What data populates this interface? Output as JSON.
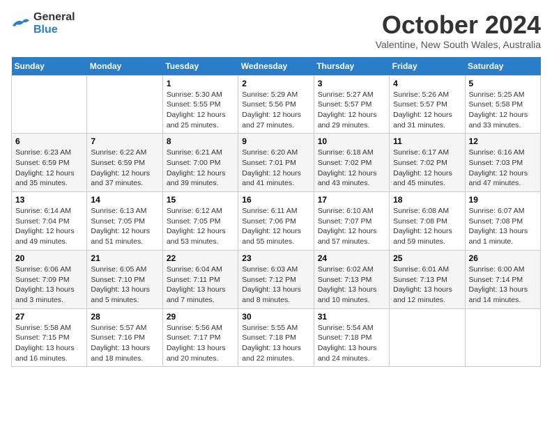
{
  "logo": {
    "line1": "General",
    "line2": "Blue"
  },
  "title": "October 2024",
  "subtitle": "Valentine, New South Wales, Australia",
  "days_header": [
    "Sunday",
    "Monday",
    "Tuesday",
    "Wednesday",
    "Thursday",
    "Friday",
    "Saturday"
  ],
  "weeks": [
    [
      {
        "day": "",
        "sunrise": "",
        "sunset": "",
        "daylight": ""
      },
      {
        "day": "",
        "sunrise": "",
        "sunset": "",
        "daylight": ""
      },
      {
        "day": "1",
        "sunrise": "Sunrise: 5:30 AM",
        "sunset": "Sunset: 5:55 PM",
        "daylight": "Daylight: 12 hours and 25 minutes."
      },
      {
        "day": "2",
        "sunrise": "Sunrise: 5:29 AM",
        "sunset": "Sunset: 5:56 PM",
        "daylight": "Daylight: 12 hours and 27 minutes."
      },
      {
        "day": "3",
        "sunrise": "Sunrise: 5:27 AM",
        "sunset": "Sunset: 5:57 PM",
        "daylight": "Daylight: 12 hours and 29 minutes."
      },
      {
        "day": "4",
        "sunrise": "Sunrise: 5:26 AM",
        "sunset": "Sunset: 5:57 PM",
        "daylight": "Daylight: 12 hours and 31 minutes."
      },
      {
        "day": "5",
        "sunrise": "Sunrise: 5:25 AM",
        "sunset": "Sunset: 5:58 PM",
        "daylight": "Daylight: 12 hours and 33 minutes."
      }
    ],
    [
      {
        "day": "6",
        "sunrise": "Sunrise: 6:23 AM",
        "sunset": "Sunset: 6:59 PM",
        "daylight": "Daylight: 12 hours and 35 minutes."
      },
      {
        "day": "7",
        "sunrise": "Sunrise: 6:22 AM",
        "sunset": "Sunset: 6:59 PM",
        "daylight": "Daylight: 12 hours and 37 minutes."
      },
      {
        "day": "8",
        "sunrise": "Sunrise: 6:21 AM",
        "sunset": "Sunset: 7:00 PM",
        "daylight": "Daylight: 12 hours and 39 minutes."
      },
      {
        "day": "9",
        "sunrise": "Sunrise: 6:20 AM",
        "sunset": "Sunset: 7:01 PM",
        "daylight": "Daylight: 12 hours and 41 minutes."
      },
      {
        "day": "10",
        "sunrise": "Sunrise: 6:18 AM",
        "sunset": "Sunset: 7:02 PM",
        "daylight": "Daylight: 12 hours and 43 minutes."
      },
      {
        "day": "11",
        "sunrise": "Sunrise: 6:17 AM",
        "sunset": "Sunset: 7:02 PM",
        "daylight": "Daylight: 12 hours and 45 minutes."
      },
      {
        "day": "12",
        "sunrise": "Sunrise: 6:16 AM",
        "sunset": "Sunset: 7:03 PM",
        "daylight": "Daylight: 12 hours and 47 minutes."
      }
    ],
    [
      {
        "day": "13",
        "sunrise": "Sunrise: 6:14 AM",
        "sunset": "Sunset: 7:04 PM",
        "daylight": "Daylight: 12 hours and 49 minutes."
      },
      {
        "day": "14",
        "sunrise": "Sunrise: 6:13 AM",
        "sunset": "Sunset: 7:05 PM",
        "daylight": "Daylight: 12 hours and 51 minutes."
      },
      {
        "day": "15",
        "sunrise": "Sunrise: 6:12 AM",
        "sunset": "Sunset: 7:05 PM",
        "daylight": "Daylight: 12 hours and 53 minutes."
      },
      {
        "day": "16",
        "sunrise": "Sunrise: 6:11 AM",
        "sunset": "Sunset: 7:06 PM",
        "daylight": "Daylight: 12 hours and 55 minutes."
      },
      {
        "day": "17",
        "sunrise": "Sunrise: 6:10 AM",
        "sunset": "Sunset: 7:07 PM",
        "daylight": "Daylight: 12 hours and 57 minutes."
      },
      {
        "day": "18",
        "sunrise": "Sunrise: 6:08 AM",
        "sunset": "Sunset: 7:08 PM",
        "daylight": "Daylight: 12 hours and 59 minutes."
      },
      {
        "day": "19",
        "sunrise": "Sunrise: 6:07 AM",
        "sunset": "Sunset: 7:08 PM",
        "daylight": "Daylight: 13 hours and 1 minute."
      }
    ],
    [
      {
        "day": "20",
        "sunrise": "Sunrise: 6:06 AM",
        "sunset": "Sunset: 7:09 PM",
        "daylight": "Daylight: 13 hours and 3 minutes."
      },
      {
        "day": "21",
        "sunrise": "Sunrise: 6:05 AM",
        "sunset": "Sunset: 7:10 PM",
        "daylight": "Daylight: 13 hours and 5 minutes."
      },
      {
        "day": "22",
        "sunrise": "Sunrise: 6:04 AM",
        "sunset": "Sunset: 7:11 PM",
        "daylight": "Daylight: 13 hours and 7 minutes."
      },
      {
        "day": "23",
        "sunrise": "Sunrise: 6:03 AM",
        "sunset": "Sunset: 7:12 PM",
        "daylight": "Daylight: 13 hours and 8 minutes."
      },
      {
        "day": "24",
        "sunrise": "Sunrise: 6:02 AM",
        "sunset": "Sunset: 7:13 PM",
        "daylight": "Daylight: 13 hours and 10 minutes."
      },
      {
        "day": "25",
        "sunrise": "Sunrise: 6:01 AM",
        "sunset": "Sunset: 7:13 PM",
        "daylight": "Daylight: 13 hours and 12 minutes."
      },
      {
        "day": "26",
        "sunrise": "Sunrise: 6:00 AM",
        "sunset": "Sunset: 7:14 PM",
        "daylight": "Daylight: 13 hours and 14 minutes."
      }
    ],
    [
      {
        "day": "27",
        "sunrise": "Sunrise: 5:58 AM",
        "sunset": "Sunset: 7:15 PM",
        "daylight": "Daylight: 13 hours and 16 minutes."
      },
      {
        "day": "28",
        "sunrise": "Sunrise: 5:57 AM",
        "sunset": "Sunset: 7:16 PM",
        "daylight": "Daylight: 13 hours and 18 minutes."
      },
      {
        "day": "29",
        "sunrise": "Sunrise: 5:56 AM",
        "sunset": "Sunset: 7:17 PM",
        "daylight": "Daylight: 13 hours and 20 minutes."
      },
      {
        "day": "30",
        "sunrise": "Sunrise: 5:55 AM",
        "sunset": "Sunset: 7:18 PM",
        "daylight": "Daylight: 13 hours and 22 minutes."
      },
      {
        "day": "31",
        "sunrise": "Sunrise: 5:54 AM",
        "sunset": "Sunset: 7:18 PM",
        "daylight": "Daylight: 13 hours and 24 minutes."
      },
      {
        "day": "",
        "sunrise": "",
        "sunset": "",
        "daylight": ""
      },
      {
        "day": "",
        "sunrise": "",
        "sunset": "",
        "daylight": ""
      }
    ]
  ]
}
